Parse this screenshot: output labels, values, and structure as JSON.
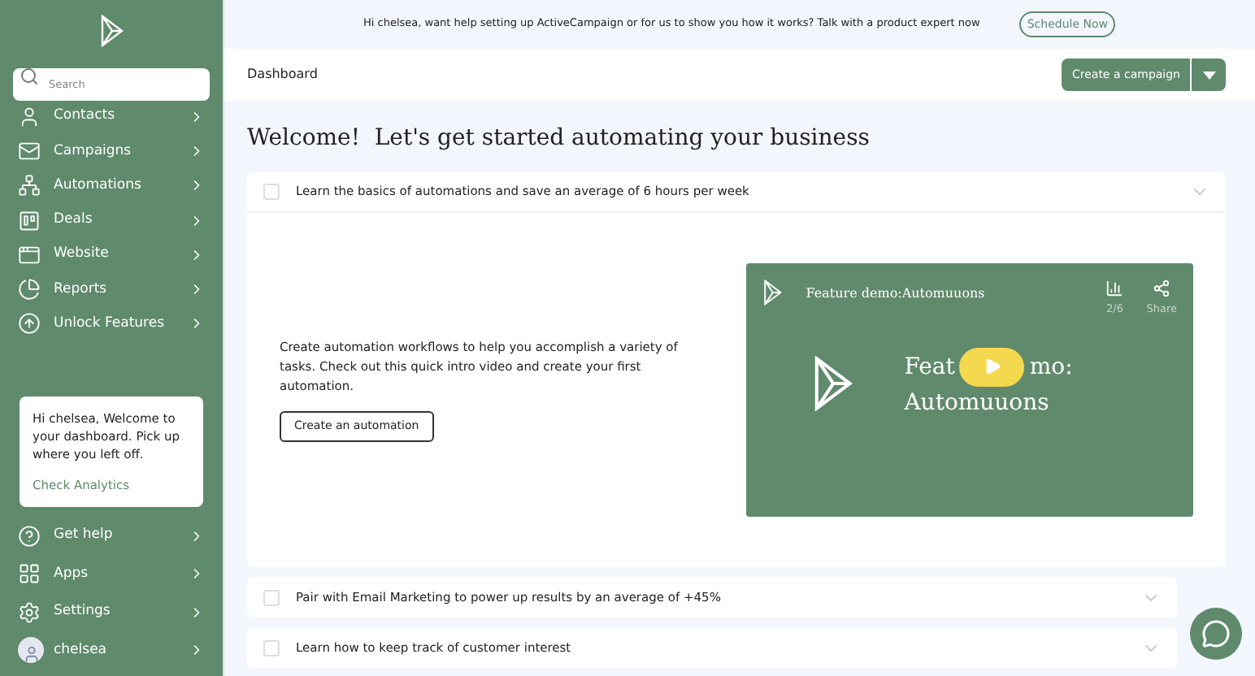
{
  "sidebar": {
    "search": {
      "placeholder": "Search"
    },
    "items": [
      {
        "label": "Contacts"
      },
      {
        "label": "Campaigns"
      },
      {
        "label": "Automations"
      },
      {
        "label": "Deals"
      },
      {
        "label": "Website"
      },
      {
        "label": "Reports"
      },
      {
        "label": "Unlock Features"
      }
    ],
    "welcome_card": {
      "text": "Hi chelsea, Welcome to your dashboard. Pick up where you left off.",
      "link": "Check Analytics"
    },
    "bottom_items": [
      {
        "label": "Get help"
      },
      {
        "label": "Apps"
      },
      {
        "label": "Settings"
      },
      {
        "label": "chelsea",
        "kind": "user"
      }
    ]
  },
  "banner": {
    "text": "Hi chelsea, want help setting up ActiveCampaign or for us to show you how it works? Talk with a product expert now",
    "button": "Schedule Now"
  },
  "header": {
    "title": "Dashboard",
    "button": "Create a campaign"
  },
  "heading": "Welcome!  Let's get started automating your business",
  "tasks": [
    {
      "label": "Learn the basics of automations and save an average of 6 hours per week",
      "checked": false,
      "expanded": true,
      "body": {
        "text": "Create automation workflows to help you accomplish a variety of tasks. Check out this quick intro video and create your first automation.",
        "button": "Create an automation",
        "video": {
          "title": "Feature demo:Automuuons",
          "counter": "2/6",
          "share": "Share",
          "big_title_start": "Feat",
          "big_title_end": "mo:",
          "big_title_line2": "Automuuons"
        }
      }
    },
    {
      "label": "Pair with Email Marketing to power up results by an average of +45%",
      "checked": false,
      "expanded": false
    },
    {
      "label": "Learn how to keep track of customer interest",
      "checked": false,
      "expanded": false
    }
  ]
}
